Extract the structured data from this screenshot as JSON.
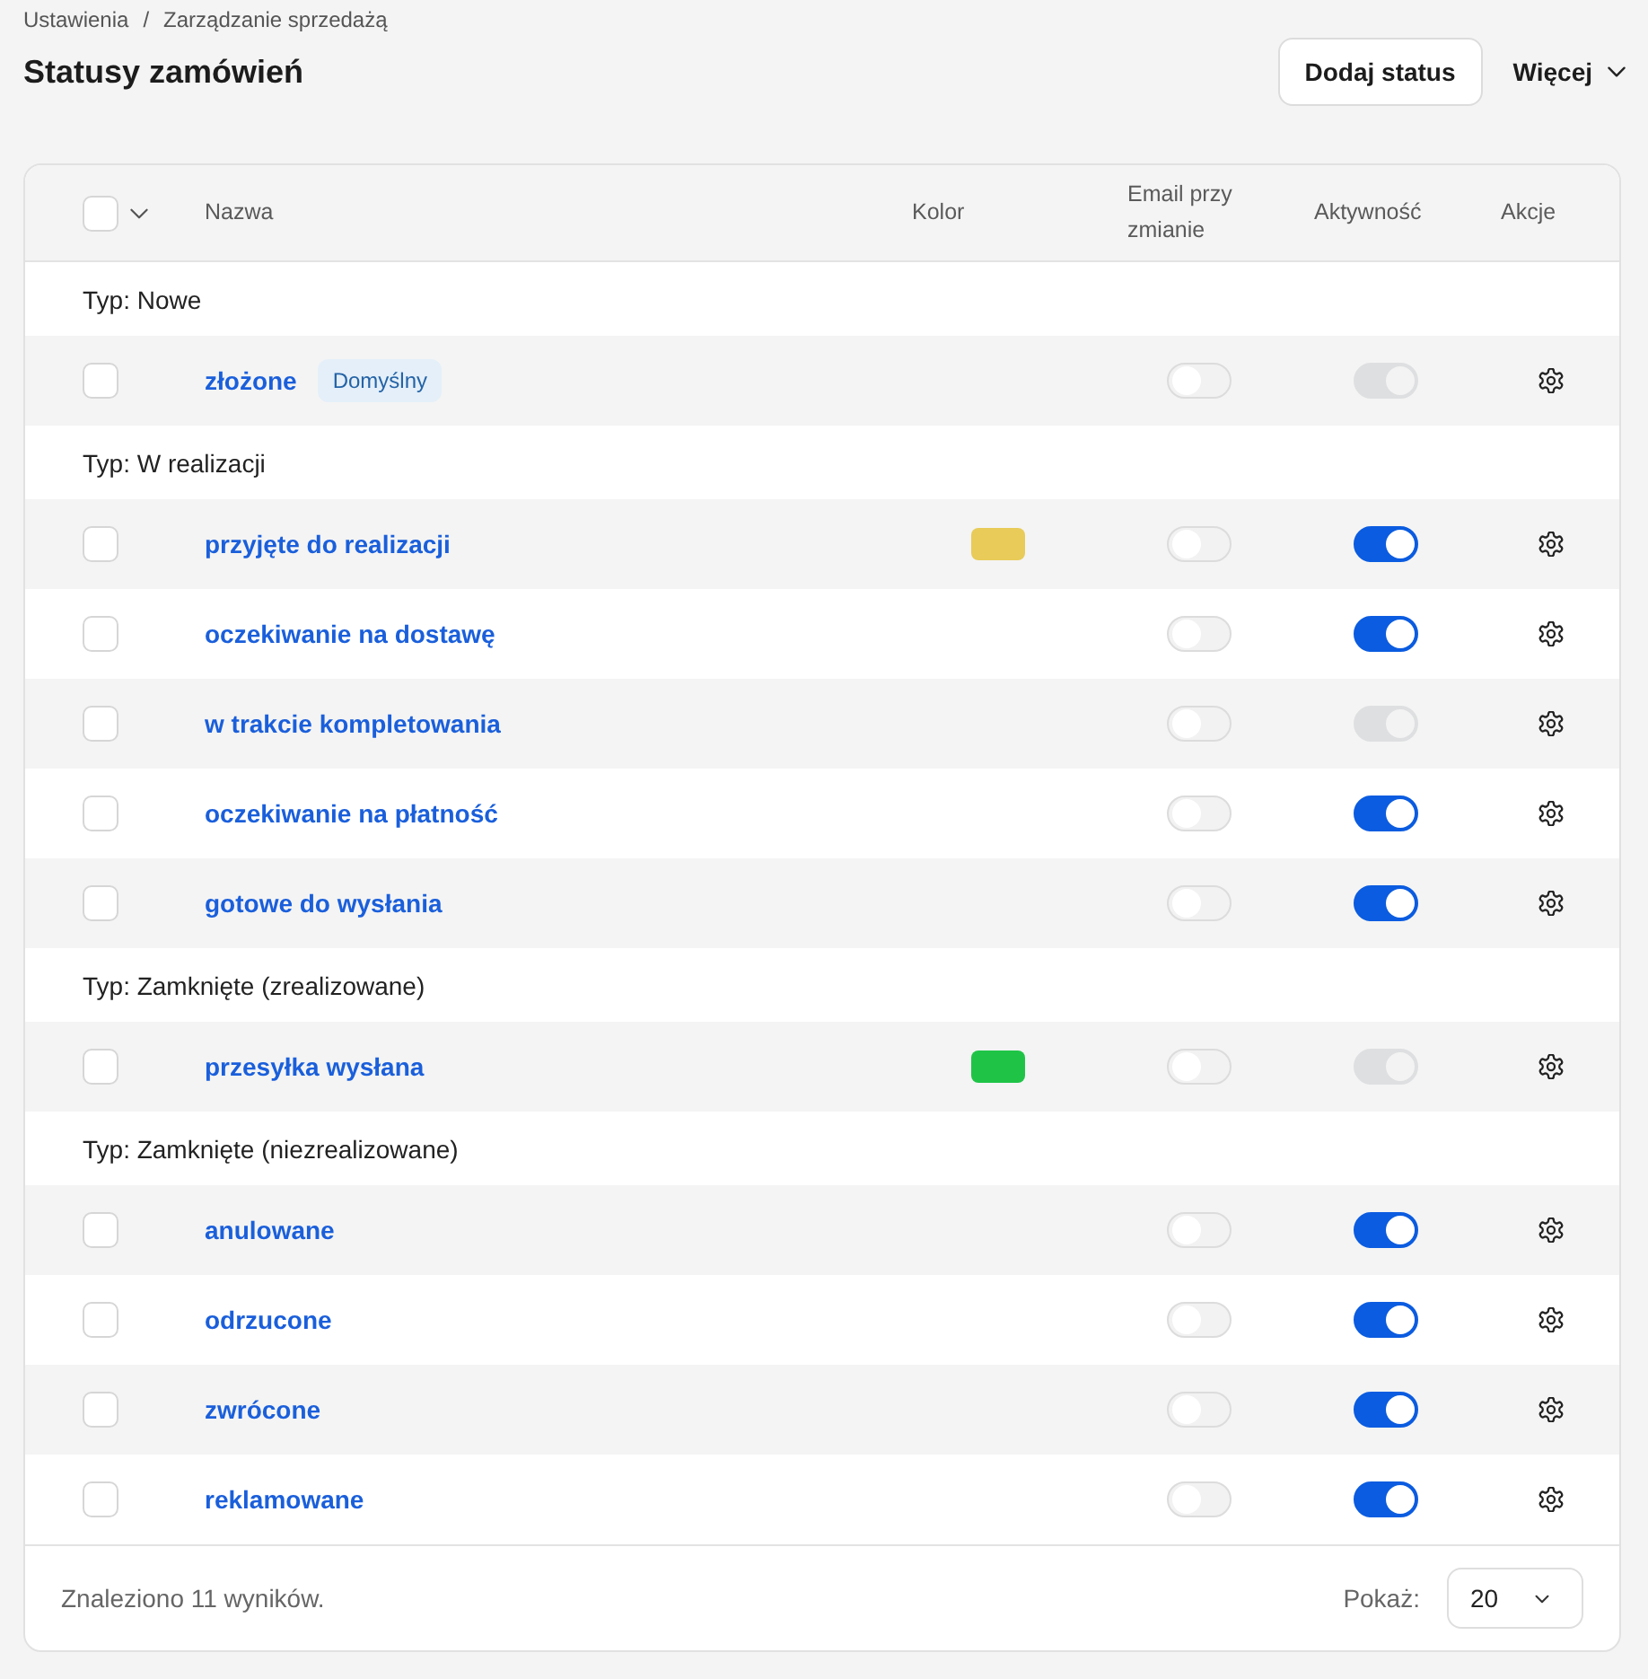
{
  "breadcrumb": {
    "items": [
      "Ustawienia",
      "Zarządzanie sprzedażą"
    ],
    "separator": "/"
  },
  "title": "Statusy zamówień",
  "actions": [
    {
      "kind": "button",
      "label": "Dodaj status"
    },
    {
      "kind": "menu",
      "label": "Więcej"
    }
  ],
  "table": {
    "select_all": {
      "checked": false
    },
    "columns": [
      "Nazwa",
      "Kolor",
      "Email przy zmianie",
      "Aktywność",
      "Akcje"
    ],
    "groups": [
      {
        "label": "Typ: Nowe",
        "rows": [
          {
            "checked": false,
            "name": "złożone",
            "badge": "Domyślny",
            "email": {
              "on": false,
              "disabled": false
            },
            "active": {
              "on": true,
              "disabled": true
            }
          }
        ]
      },
      {
        "label": "Typ: W realizacji",
        "rows": [
          {
            "checked": false,
            "name": "przyjęte do realizacji",
            "color": "#e8cb58",
            "email": {
              "on": false,
              "disabled": false
            },
            "active": {
              "on": true,
              "disabled": false
            }
          },
          {
            "checked": false,
            "name": "oczekiwanie na dostawę",
            "email": {
              "on": false,
              "disabled": false
            },
            "active": {
              "on": true,
              "disabled": false
            }
          },
          {
            "checked": false,
            "name": "w trakcie kompletowania",
            "email": {
              "on": false,
              "disabled": false
            },
            "active": {
              "on": true,
              "disabled": true
            }
          },
          {
            "checked": false,
            "name": "oczekiwanie na płatność",
            "email": {
              "on": false,
              "disabled": false
            },
            "active": {
              "on": true,
              "disabled": false
            }
          },
          {
            "checked": false,
            "name": "gotowe do wysłania",
            "email": {
              "on": false,
              "disabled": false
            },
            "active": {
              "on": true,
              "disabled": false
            }
          }
        ]
      },
      {
        "label": "Typ: Zamknięte (zrealizowane)",
        "rows": [
          {
            "checked": false,
            "name": "przesyłka wysłana",
            "color": "#1fc447",
            "email": {
              "on": false,
              "disabled": false
            },
            "active": {
              "on": true,
              "disabled": true
            }
          }
        ]
      },
      {
        "label": "Typ: Zamknięte (niezrealizowane)",
        "rows": [
          {
            "checked": false,
            "name": "anulowane",
            "email": {
              "on": false,
              "disabled": false
            },
            "active": {
              "on": true,
              "disabled": false
            }
          },
          {
            "checked": false,
            "name": "odrzucone",
            "email": {
              "on": false,
              "disabled": false
            },
            "active": {
              "on": true,
              "disabled": false
            }
          },
          {
            "checked": false,
            "name": "zwrócone",
            "email": {
              "on": false,
              "disabled": false
            },
            "active": {
              "on": true,
              "disabled": false
            }
          },
          {
            "checked": false,
            "name": "reklamowane",
            "email": {
              "on": false,
              "disabled": false
            },
            "active": {
              "on": true,
              "disabled": false
            }
          }
        ]
      }
    ]
  },
  "footer": {
    "summary": "Znaleziono 11 wyników.",
    "page_size_label": "Pokaż:",
    "page_size": "20"
  }
}
